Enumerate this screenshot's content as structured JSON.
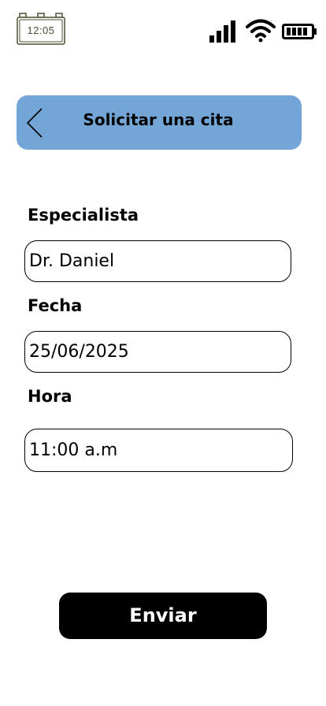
{
  "status_bar": {
    "time": "12:05",
    "icons": [
      "clock-icon",
      "signal-icon",
      "wifi-icon",
      "battery-icon"
    ]
  },
  "header": {
    "title": "Solicitar una cita",
    "back_icon": "chevron-left-icon",
    "background_color": "#73a5d7"
  },
  "form": {
    "fields": [
      {
        "label": "Especialista",
        "value": "Dr. Daniel"
      },
      {
        "label": "Fecha",
        "value": "25/06/2025"
      },
      {
        "label": "Hora",
        "value": "11:00 a.m"
      }
    ]
  },
  "submit": {
    "label": "Enviar",
    "background_color": "#000000"
  }
}
